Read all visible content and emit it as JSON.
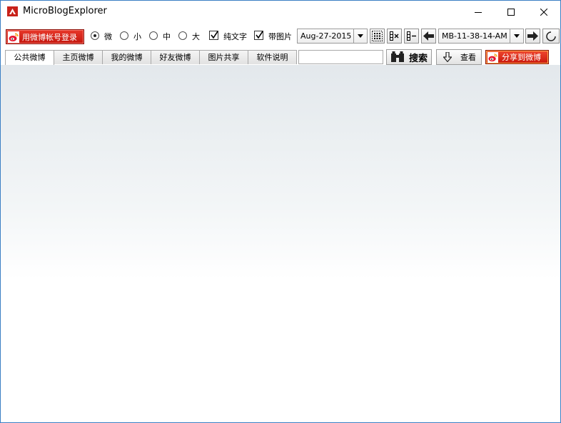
{
  "window": {
    "title": "MicroBlogExplorer"
  },
  "toolbar": {
    "login_label": "用微博帐号登录",
    "size_options": [
      {
        "label": "微",
        "selected": true
      },
      {
        "label": "小",
        "selected": false
      },
      {
        "label": "中",
        "selected": false
      },
      {
        "label": "大",
        "selected": false
      }
    ],
    "text_only": {
      "label": "纯文字",
      "checked": true
    },
    "with_images": {
      "label": "带图片",
      "checked": true
    },
    "date_value": "Aug-27-2015",
    "file_value": "MB-11-38-14-AM"
  },
  "tabs": [
    {
      "label": "公共微博",
      "active": true
    },
    {
      "label": "主页微博",
      "active": false
    },
    {
      "label": "我的微博",
      "active": false
    },
    {
      "label": "好友微博",
      "active": false
    },
    {
      "label": "图片共享",
      "active": false
    },
    {
      "label": "软件说明",
      "active": false
    }
  ],
  "search": {
    "value": "",
    "button_label": "搜索"
  },
  "view_label": "查看",
  "share_label": "分享到微博",
  "colors": {
    "accent_red": "#d9251a",
    "window_border": "#3b7fc4"
  }
}
